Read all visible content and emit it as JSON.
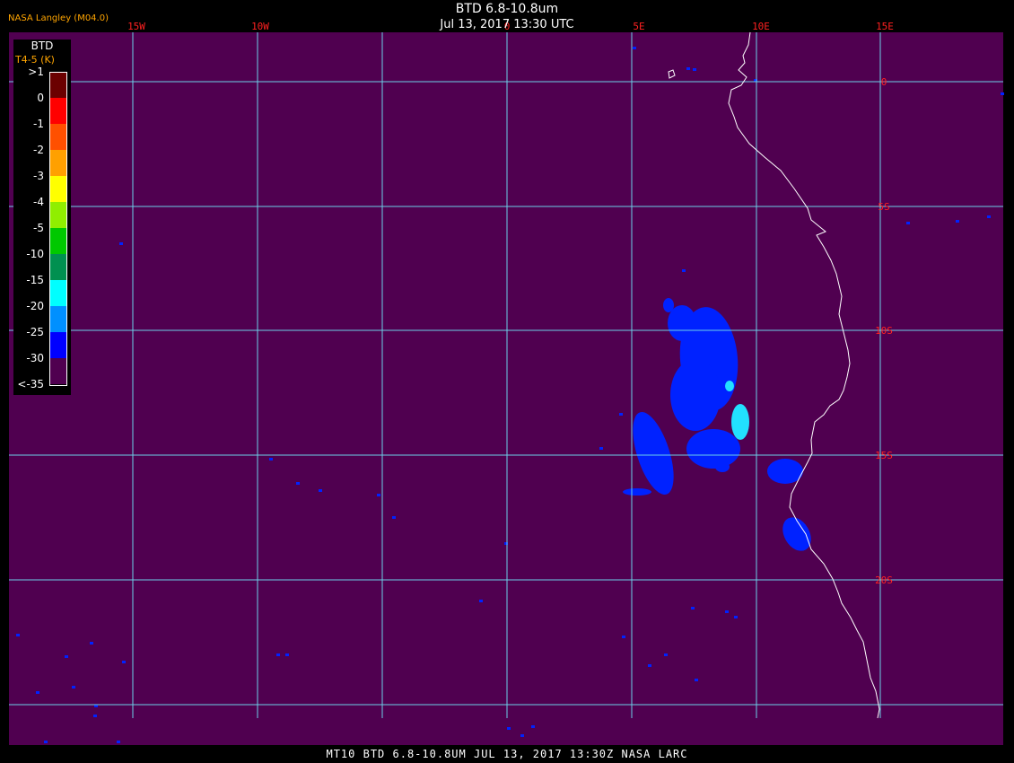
{
  "header": {
    "title": "BTD 6.8-10.8um",
    "subtitle": "Jul 13, 2017 13:30 UTC",
    "brand": "NASA Langley (M04.0)"
  },
  "footer": {
    "caption": "MT10  BTD 6.8-10.8UM   JUL 13, 2017 13:30Z   NASA LARC"
  },
  "legend": {
    "title": "BTD",
    "subtitle": "T4-5 (K)",
    "items": [
      {
        "label": ">1",
        "color": "#6b0000"
      },
      {
        "label": "0",
        "color": "#ff0000"
      },
      {
        "label": "-1",
        "color": "#ff5000"
      },
      {
        "label": "-2",
        "color": "#ffa000"
      },
      {
        "label": "-3",
        "color": "#ffff00"
      },
      {
        "label": "-4",
        "color": "#90ee00"
      },
      {
        "label": "-5",
        "color": "#00c800"
      },
      {
        "label": "-10",
        "color": "#009050"
      },
      {
        "label": "-15",
        "color": "#00ffff"
      },
      {
        "label": "-20",
        "color": "#0090ff"
      },
      {
        "label": "-25",
        "color": "#0000ff"
      },
      {
        "label": "-30",
        "color": "#500050"
      },
      {
        "label": "<-35",
        "color": ""
      }
    ]
  },
  "map": {
    "background_color": "#500050",
    "grid_color": "#6cd0e8",
    "coast_color": "#ffffff",
    "cloud_color": "#0022ff",
    "grid_label_color": "#ff2020",
    "lon_labels": [
      "15W",
      "10W",
      "0",
      "5E",
      "10E",
      "15E"
    ],
    "lat_labels": [
      "0",
      "5S",
      "10S",
      "15S",
      "20S"
    ]
  }
}
